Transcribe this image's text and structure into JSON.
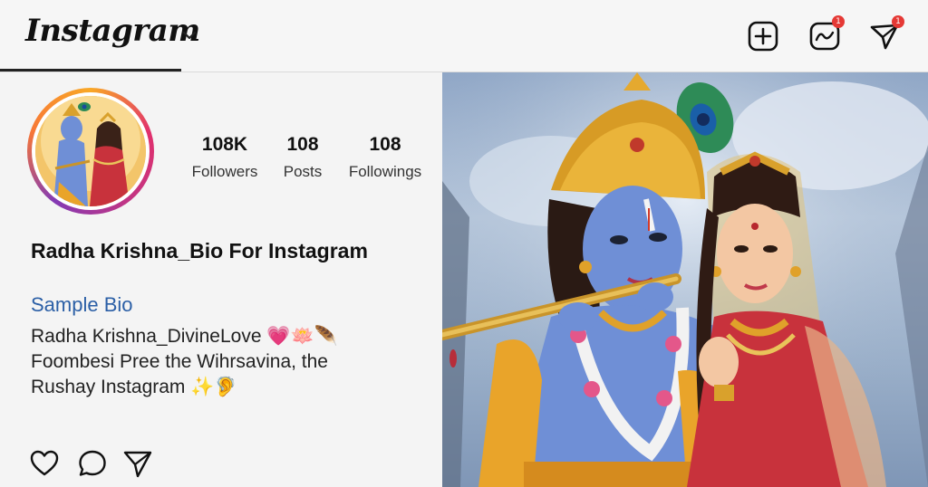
{
  "header": {
    "logo_text": "Instagram",
    "new_post_icon": "plus-square-icon",
    "activity_icon": "activity-icon",
    "activity_badge": "1",
    "direct_icon": "send-icon",
    "direct_badge": "1"
  },
  "profile": {
    "stats": [
      {
        "value": "108K",
        "label": "Followers"
      },
      {
        "value": "108",
        "label": "Posts"
      },
      {
        "value": "108",
        "label": "Followings"
      }
    ],
    "name": "Radha Krishna_Bio For Instagram",
    "bio_title": "Sample Bio",
    "bio_lines": [
      "Radha Krishna_DivineLove 💗🪷🪶",
      "Foombesi Pree the Wihrsavina,  the",
      "Rushay Instagram ✨🦻"
    ]
  },
  "actions": {
    "like_icon": "heart-icon",
    "comment_icon": "comment-icon",
    "share_icon": "send-icon"
  },
  "colors": {
    "bio_link": "#2b5fa6",
    "badge": "#e53935",
    "krishna_skin": "#6f8fd6",
    "gold": "#e0a12a",
    "radha_saree": "#c8323c"
  }
}
